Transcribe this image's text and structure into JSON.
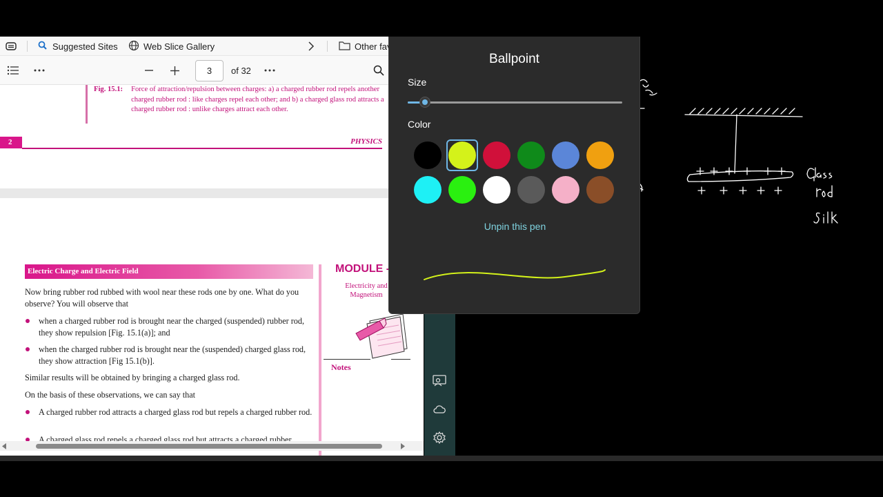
{
  "favorites_bar": {
    "items": [
      {
        "label": "Suggested Sites"
      },
      {
        "label": "Web Slice Gallery"
      },
      {
        "label": "Other fav"
      }
    ]
  },
  "pdf_toolbar": {
    "current_page": "3",
    "page_of": "of 32"
  },
  "document": {
    "fig_caption_label": "Fig. 15.1:",
    "fig_caption_text": "Force of attraction/repulsion between charges:  a) a charged rubber rod repels another charged rubber rod : like charges repel each other; and b) a charged glass rod attracts a charged rubber rod : unlike charges attract each other.",
    "page_number": "2",
    "running_header": "PHYSICS",
    "section_header": "Electric Charge and Electric Field",
    "module_title": "MODULE -",
    "module_subtitle": "Electricity and Magnetism",
    "notes_label": "Notes",
    "para1": "Now bring rubber rod rubbed with wool near these rods one by one. What do you observe? You will observe that",
    "bullet1": "when a charged rubber rod is brought near the charged (suspended) rubber rod, they show repulsion [Fig. 15.1(a)]; and",
    "bullet2": "when the charged rubber rod is brought near the (suspended) charged glass rod, they show attraction [Fig 15.1(b)].",
    "para2": "Similar results will be obtained by bringing a charged glass rod.",
    "para3": "On the basis of these observations, we can say that",
    "bullet3": "A charged rubber rod attracts a charged glass rod but repels a charged rubber rod.",
    "bullet4": "A charged glass rod repels a charged glass rod but attracts a charged rubber"
  },
  "pen_panel": {
    "title": "Ballpoint",
    "size_label": "Size",
    "size_value_fraction": 0.08,
    "color_label": "Color",
    "selected_color": "#d4f21a",
    "colors": [
      "#000000",
      "#d4f21a",
      "#d0103a",
      "#0f8a1a",
      "#5b86d8",
      "#f0a010",
      "#1ef0f5",
      "#2af010",
      "#ffffff",
      "#5a5a5a",
      "#f5b0c8",
      "#8a4e28"
    ],
    "unpin_label": "Unpin this pen"
  },
  "whiteboard": {
    "handwritten_label_1": "Glass rod",
    "handwritten_label_2": "Silk"
  },
  "colors": {
    "accent_magenta": "#c2117a",
    "panel_bg": "#2b2b2b",
    "accent_blue": "#6fb7e6"
  }
}
